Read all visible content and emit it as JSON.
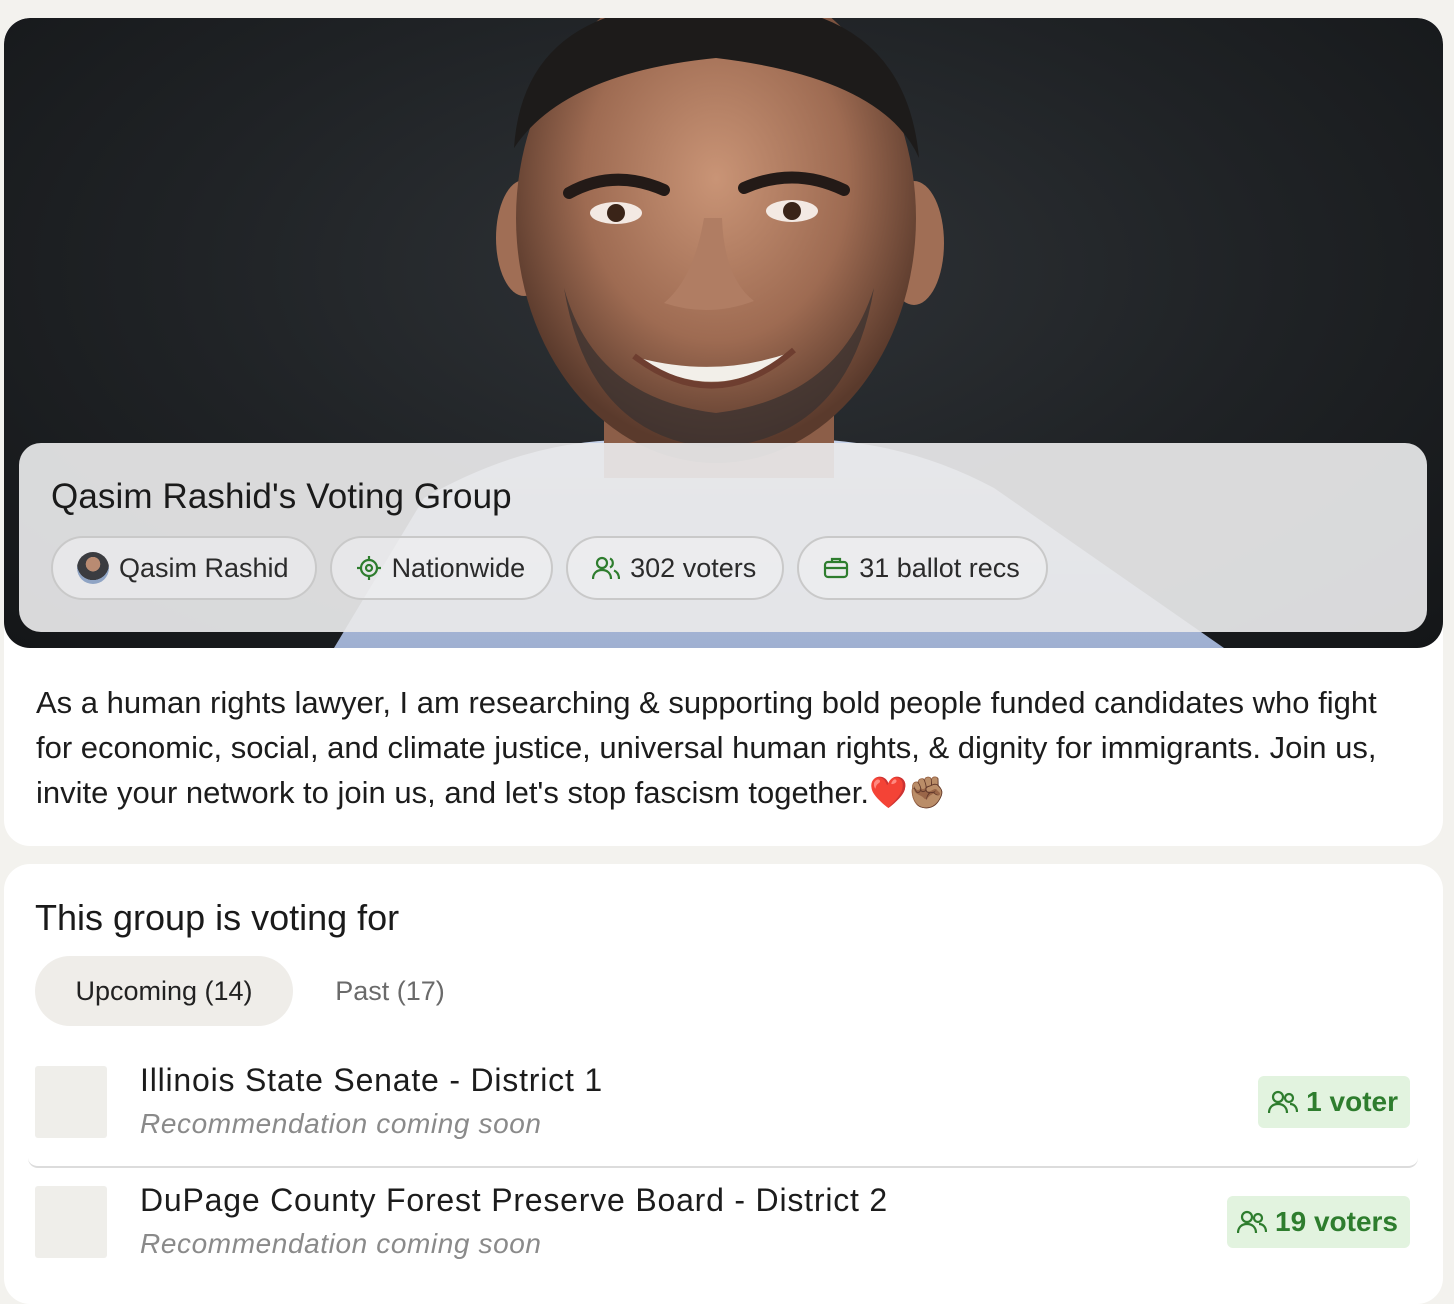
{
  "group": {
    "title": "Qasim Rashid's Voting Group",
    "owner": "Qasim Rashid",
    "scope": "Nationwide",
    "voters": "302 voters",
    "ballot_recs": "31 ballot recs",
    "description": "As a human rights lawyer, I am researching & supporting bold people funded candidates who fight for economic, social, and climate justice, universal human rights, & dignity for immigrants. Join us, invite your network to join us, and let's stop fascism together.❤️✊🏽"
  },
  "voting": {
    "heading": "This group is voting for",
    "tabs": [
      {
        "label": "Upcoming (14)",
        "active": true
      },
      {
        "label": "Past (17)",
        "active": false
      }
    ],
    "races": [
      {
        "name": "Illinois State Senate - District 1",
        "status": "Recommendation coming soon",
        "voters": "1 voter"
      },
      {
        "name": "DuPage County Forest Preserve Board - District 2",
        "status": "Recommendation coming soon",
        "voters": "19 voters"
      }
    ]
  },
  "colors": {
    "accent_green": "#2e7d2e",
    "badge_bg": "#e2f3df",
    "page_bg": "#f3f2ee"
  },
  "icons": [
    "avatar",
    "target-icon",
    "users-icon",
    "briefcase-icon"
  ]
}
